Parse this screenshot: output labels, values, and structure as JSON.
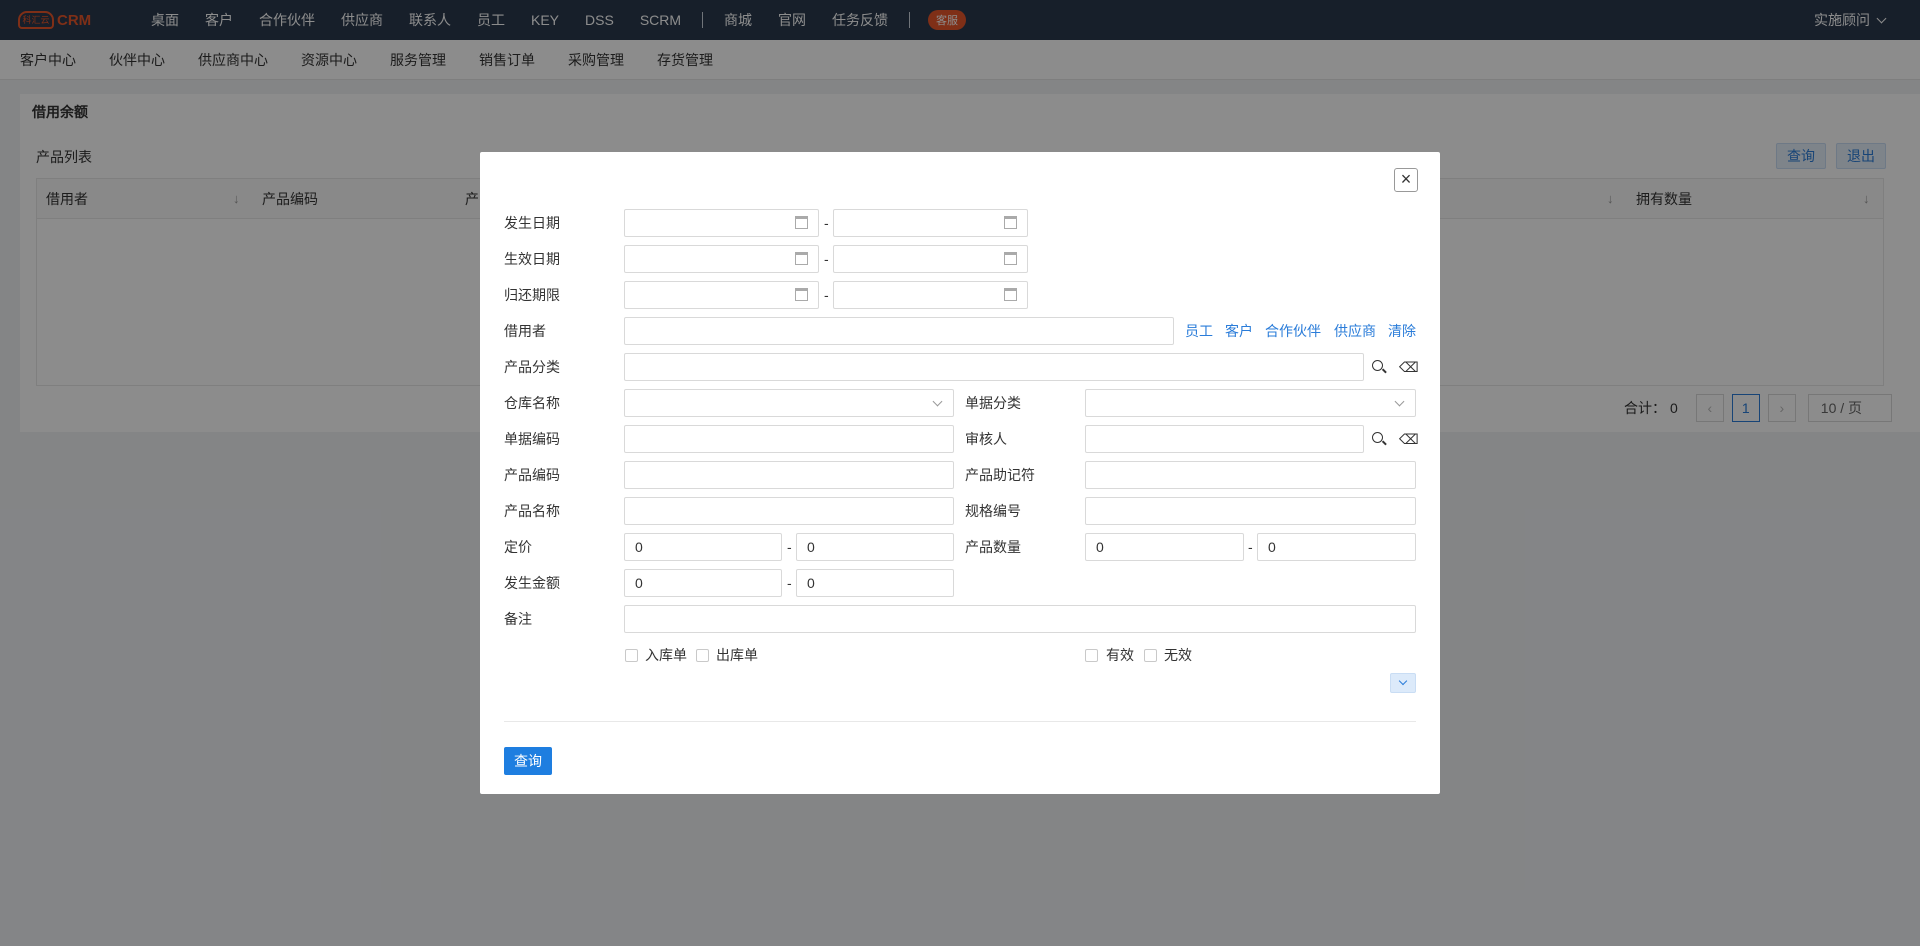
{
  "topnav": {
    "logo_badge": "科汇云",
    "logo_text": "CRM",
    "items": [
      "桌面",
      "客户",
      "合作伙伴",
      "供应商",
      "联系人",
      "员工",
      "KEY",
      "DSS",
      "SCRM"
    ],
    "items2": [
      "商城",
      "官网",
      "任务反馈"
    ],
    "kefu": "客服",
    "user": "实施顾问"
  },
  "subnav": {
    "items": [
      "客户中心",
      "伙伴中心",
      "供应商中心",
      "资源中心",
      "服务管理",
      "销售订单",
      "采购管理",
      "存货管理"
    ]
  },
  "page": {
    "title": "借用余额",
    "card_title": "产品列表",
    "query_btn": "查询",
    "exit_btn": "退出",
    "columns": [
      "借用者",
      "产品编码",
      "产",
      "拥有数量"
    ],
    "total_label": "合计：",
    "total_value": "0",
    "current_page": "1",
    "page_size": "10 / 页"
  },
  "modal": {
    "labels": {
      "occur_date": "发生日期",
      "effective_date": "生效日期",
      "return_deadline": "归还期限",
      "borrower": "借用者",
      "product_category": "产品分类",
      "warehouse_name": "仓库名称",
      "doc_category": "单据分类",
      "doc_code": "单据编码",
      "reviewer": "审核人",
      "product_code": "产品编码",
      "product_mnemonic": "产品助记符",
      "product_name": "产品名称",
      "spec_no": "规格编号",
      "list_price": "定价",
      "product_qty": "产品数量",
      "occur_amount": "发生金额",
      "remark": "备注"
    },
    "dash": "-",
    "borrower_links": [
      "员工",
      "客户",
      "合作伙伴",
      "供应商",
      "清除"
    ],
    "price_from": "0",
    "price_to": "0",
    "qty_from": "0",
    "qty_to": "0",
    "amount_from": "0",
    "amount_to": "0",
    "checkboxes": {
      "in_stock": "入库单",
      "out_stock": "出库单",
      "valid": "有效",
      "invalid": "无效"
    },
    "query_btn": "查询",
    "close_glyph": "×"
  }
}
